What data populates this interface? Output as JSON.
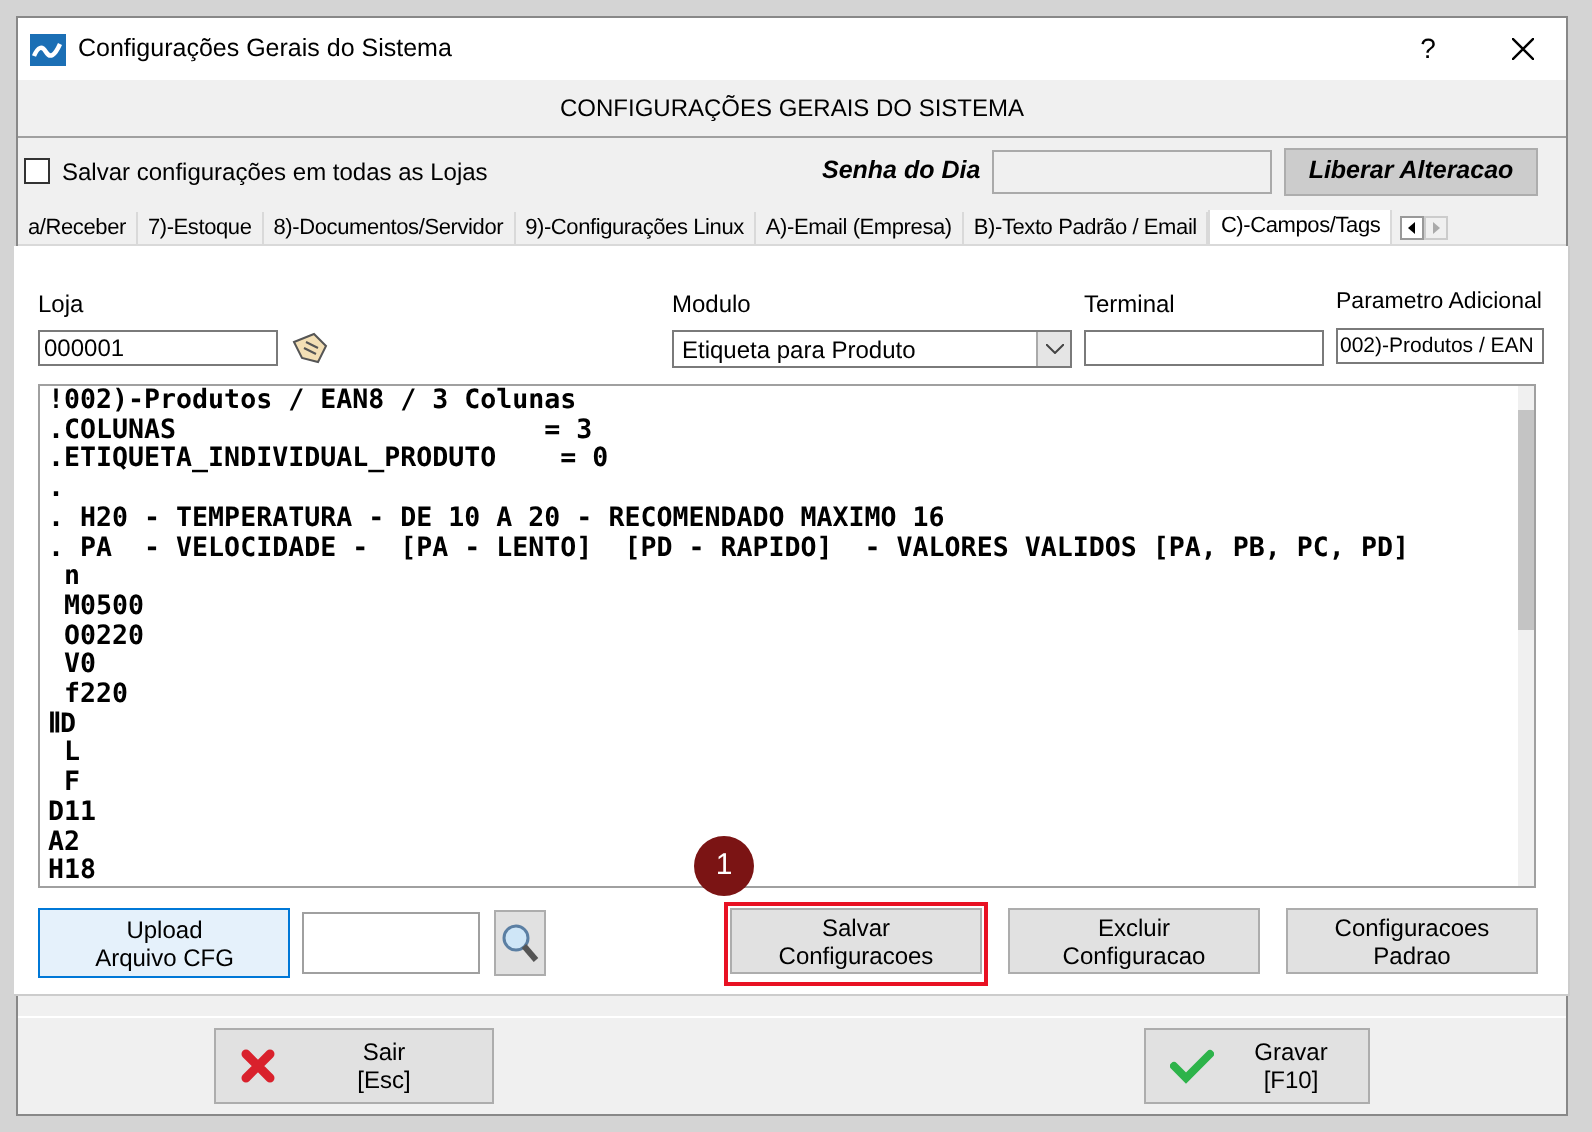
{
  "window": {
    "title": "Configurações Gerais do Sistema",
    "header": "CONFIGURAÇÕES GERAIS DO SISTEMA",
    "help": "?"
  },
  "top_bar": {
    "save_all": {
      "label": "Salvar configurações em todas as Lojas",
      "checked": false
    },
    "password_label": "Senha do Dia",
    "release_button": "Liberar Alteracao"
  },
  "tabs": [
    {
      "label": "a/Receber",
      "selected": false
    },
    {
      "label": "7)-Estoque",
      "selected": false
    },
    {
      "label": "8)-Documentos/Servidor",
      "selected": false
    },
    {
      "label": "9)-Configurações Linux",
      "selected": false
    },
    {
      "label": "A)-Email (Empresa)",
      "selected": false
    },
    {
      "label": "B)-Texto Padrão / Email",
      "selected": false
    },
    {
      "label": "C)-Campos/Tags",
      "selected": true
    }
  ],
  "form": {
    "loja": {
      "label": "Loja",
      "value": "000001"
    },
    "modulo": {
      "label": "Modulo",
      "value": "Etiqueta para Produto"
    },
    "terminal": {
      "label": "Terminal"
    },
    "parametro": {
      "label": "Parametro Adicional",
      "value": "002)-Produtos / EAN"
    }
  },
  "editor_lines": [
    "!002)-Produtos / EAN8 / 3 Colunas",
    ".COLUNAS                       = 3",
    ".ETIQUETA_INDIVIDUAL_PRODUTO    = 0",
    ".",
    ". H20 - TEMPERATURA - DE 10 A 20 - RECOMENDADO MAXIMO 16",
    ". PA  - VELOCIDADE -  [PA - LENTO]  [PD - RAPIDO]  - VALORES VALIDOS [PA, PB, PC, PD]",
    " n",
    " M0500",
    " O0220",
    " V0",
    " f220",
    "ⅡD",
    " L",
    " F",
    "D11",
    "A2",
    "H18"
  ],
  "actions": [
    {
      "kind": "upload",
      "label": "Upload\nArquivo CFG"
    },
    {
      "kind": "file"
    },
    {
      "kind": "search"
    },
    {
      "kind": "action",
      "label": "Salvar\nConfiguracoes",
      "highlighted": true,
      "marker": "1"
    },
    {
      "kind": "action",
      "label": "Excluir\nConfiguracao",
      "highlighted": false
    },
    {
      "kind": "action",
      "label": "Configuracoes\nPadrao",
      "highlighted": false
    }
  ],
  "footer": [
    {
      "kind": "exit",
      "label": "Sair\n[Esc]"
    },
    {
      "kind": "save",
      "label": "Gravar\n[F10]"
    }
  ]
}
